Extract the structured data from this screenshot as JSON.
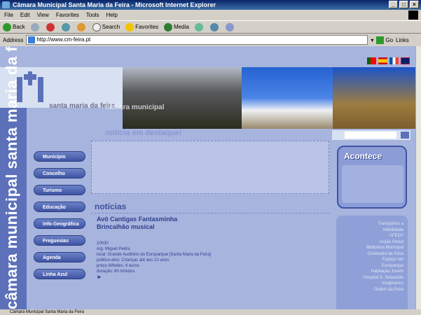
{
  "window": {
    "title": "Câmara Municipal Santa Maria da Feira - Microsoft Internet Explorer"
  },
  "menu": [
    "File",
    "Edit",
    "View",
    "Favorites",
    "Tools",
    "Help"
  ],
  "toolbar": {
    "back": "Back",
    "search": "Search",
    "favorites": "Favorites",
    "media": "Media"
  },
  "address": {
    "label": "Address",
    "url": "http://www.cm-feira.pt",
    "go": "Go",
    "links": "Links"
  },
  "site": {
    "brand": "santa maria da feira",
    "photo_caption": "câmara municipal",
    "vertical_title": "câmara municipal santa maria da feira",
    "destaque": "notícia em destaque!",
    "nav": [
      "Município",
      "Concelho",
      "Turismo",
      "Educação",
      "Info-Geográfica",
      "Freguesias",
      "Agenda",
      "Linha Azul"
    ],
    "noticias_heading": "notícias",
    "news_title": "Avô Cantigas Fantasminha Brincalhão musical",
    "news_lines": [
      "10h30",
      "org. Miguel Pedra",
      "local: Grande Auditório do Europarque [Santa Maria da Feira]",
      "público-alvo: Crianças até aos 10 anos",
      "preço bilhetes: 4 euros",
      "duração: 60 minutos"
    ],
    "acontece": "Acontece",
    "links": [
      "Transportes a",
      "Mobilidade",
      "AFEDV",
      "Acção Social",
      "Biblioteca Municipal",
      "Cineteatro da Feira",
      "Espaço net",
      "Europarque",
      "Habitação Jovem",
      "Hospital S. Sebastião",
      "Imaginarius",
      "Ordem da Feira"
    ]
  },
  "status": {
    "text": "Câmara Municipal Santa Maria da Feira"
  }
}
